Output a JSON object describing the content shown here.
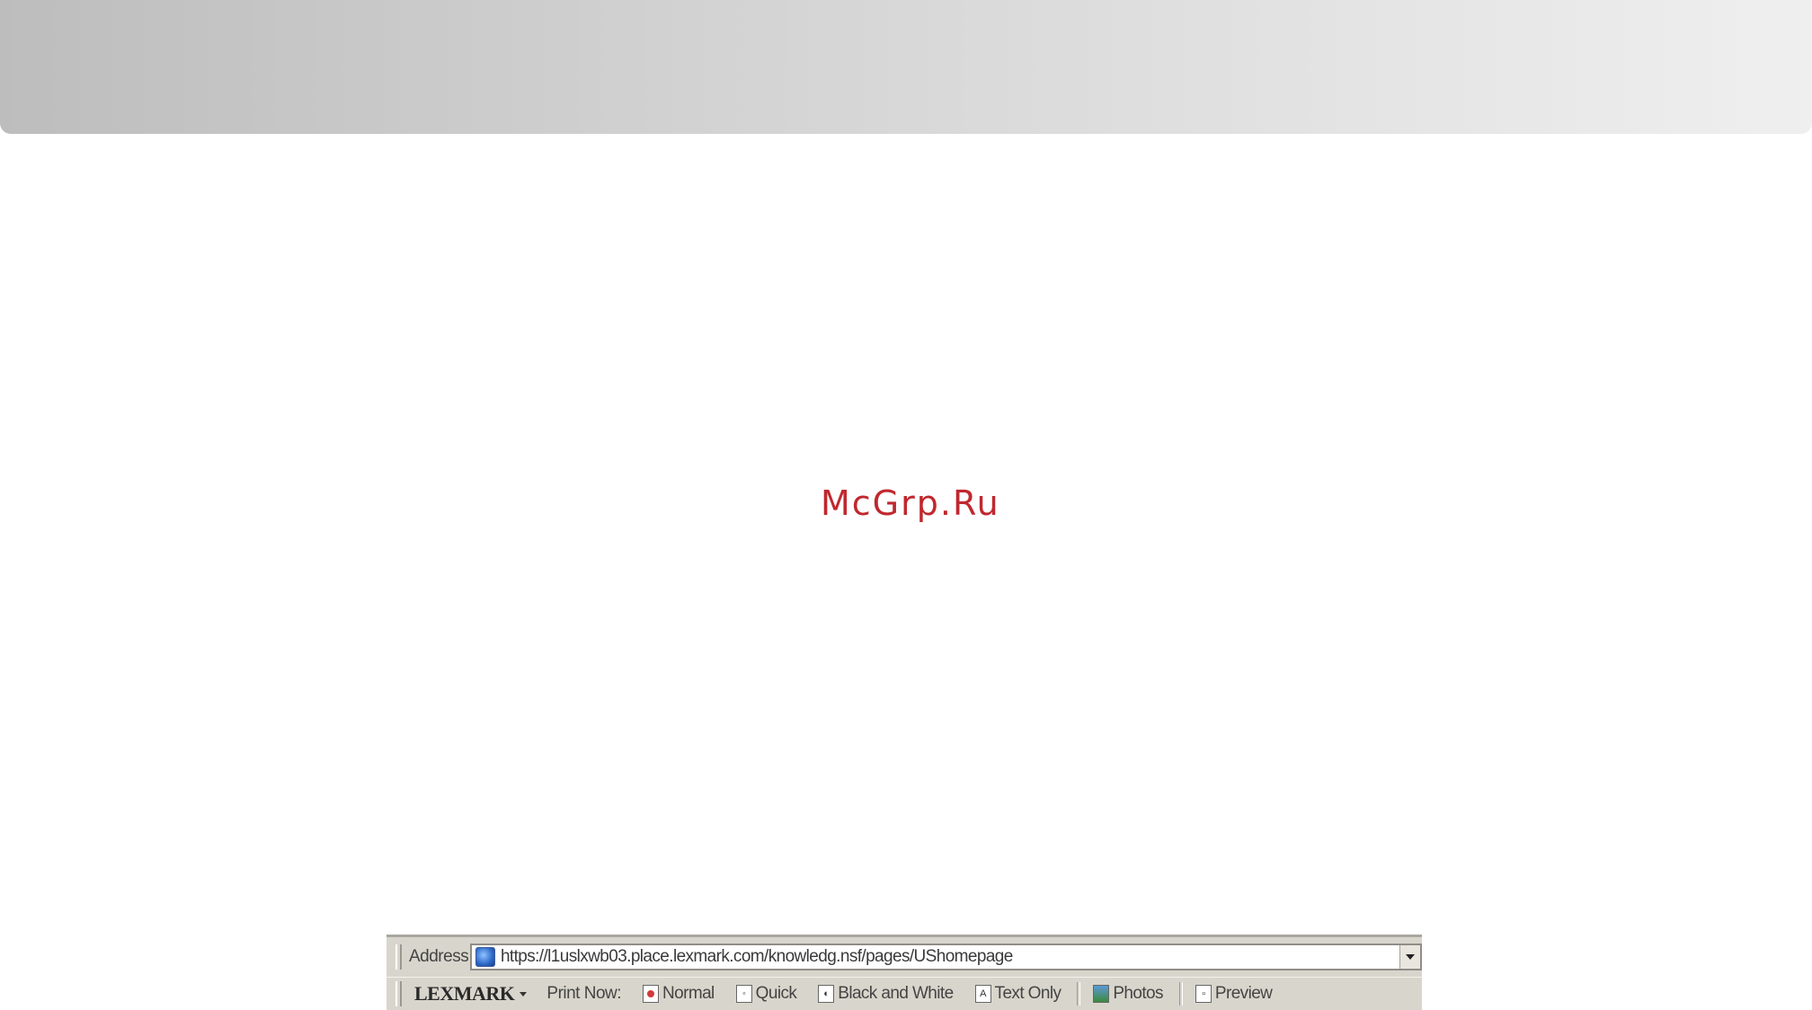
{
  "watermark": {
    "text": "McGrp.Ru",
    "color": "#c0282e"
  },
  "address_bar": {
    "label": "Address",
    "url": "https://l1uslxwb03.place.lexmark.com/knowledg.nsf/pages/UShomepage",
    "page_icon": "ie-page-icon",
    "dropdown_icon": "chevron-down-icon"
  },
  "lexmark_toolbar": {
    "brand": "LEXMARK",
    "print_now_label": "Print Now:",
    "buttons": [
      {
        "label": "Normal",
        "icon": "print-normal-icon"
      },
      {
        "label": "Quick",
        "icon": "print-quick-icon"
      },
      {
        "label": "Black and White",
        "icon": "print-bw-icon"
      },
      {
        "label": "Text Only",
        "icon": "print-text-icon"
      },
      {
        "label": "Photos",
        "icon": "print-photos-icon"
      },
      {
        "label": "Preview",
        "icon": "print-preview-icon"
      }
    ]
  }
}
